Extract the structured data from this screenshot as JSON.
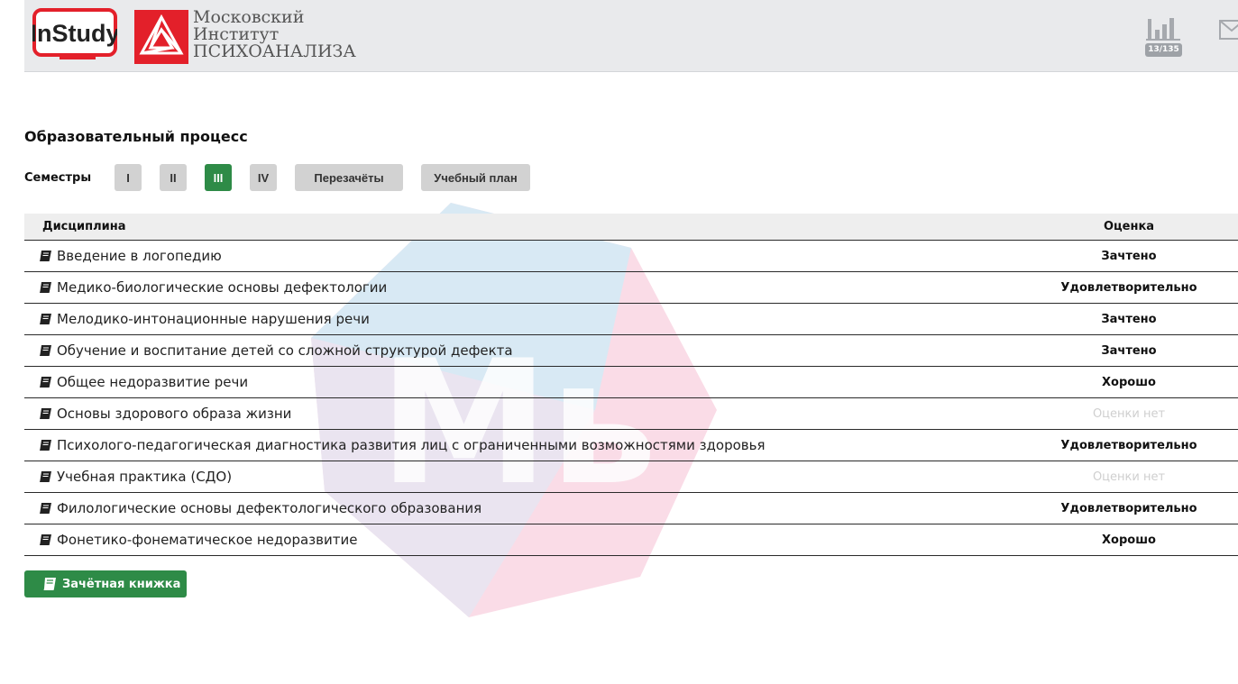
{
  "header": {
    "app_logo_text": "InStudy",
    "institute_line1": "Московский",
    "institute_line2": "Институт",
    "institute_line3": "ПСИХОАНАЛИЗА",
    "stats_badge": "13/135",
    "icons": [
      "bar-chart-icon",
      "mail-icon"
    ]
  },
  "watermark_letter": "Мь",
  "page_title": "Образовательный процесс",
  "semesters": {
    "label": "Семестры",
    "items": [
      "I",
      "II",
      "III",
      "IV"
    ],
    "active": "III",
    "extra": [
      "Перезачёты",
      "Учебный план"
    ]
  },
  "table": {
    "headers": {
      "discipline": "Дисциплина",
      "grade": "Оценка"
    },
    "rows": [
      {
        "discipline": "Введение в логопедию",
        "grade": "Зачтено"
      },
      {
        "discipline": "Медико-биологические основы дефектологии",
        "grade": "Удовлетворительно"
      },
      {
        "discipline": "Мелодико-интонационные нарушения речи",
        "grade": "Зачтено"
      },
      {
        "discipline": "Обучение и воспитание детей со сложной структурой дефекта",
        "grade": "Зачтено"
      },
      {
        "discipline": "Общее недоразвитие речи",
        "grade": "Хорошо"
      },
      {
        "discipline": "Основы здорового образа жизни",
        "grade": "Оценки нет"
      },
      {
        "discipline": "Психолого-педагогическая диагностика развития лиц с ограниченными возможностями здоровья",
        "grade": "Удовлетворительно"
      },
      {
        "discipline": "Учебная практика (СДО)",
        "grade": "Оценки нет"
      },
      {
        "discipline": "Филологические основы дефектологического образования",
        "grade": "Удовлетворительно"
      },
      {
        "discipline": "Фонетико-фонематическое недоразвитие",
        "grade": "Хорошо"
      }
    ]
  },
  "record_book_button": "Зачётная книжка",
  "colors": {
    "accent": "#2e8b47",
    "brand_red": "#e3202a",
    "header_bg": "#e9eaec"
  }
}
